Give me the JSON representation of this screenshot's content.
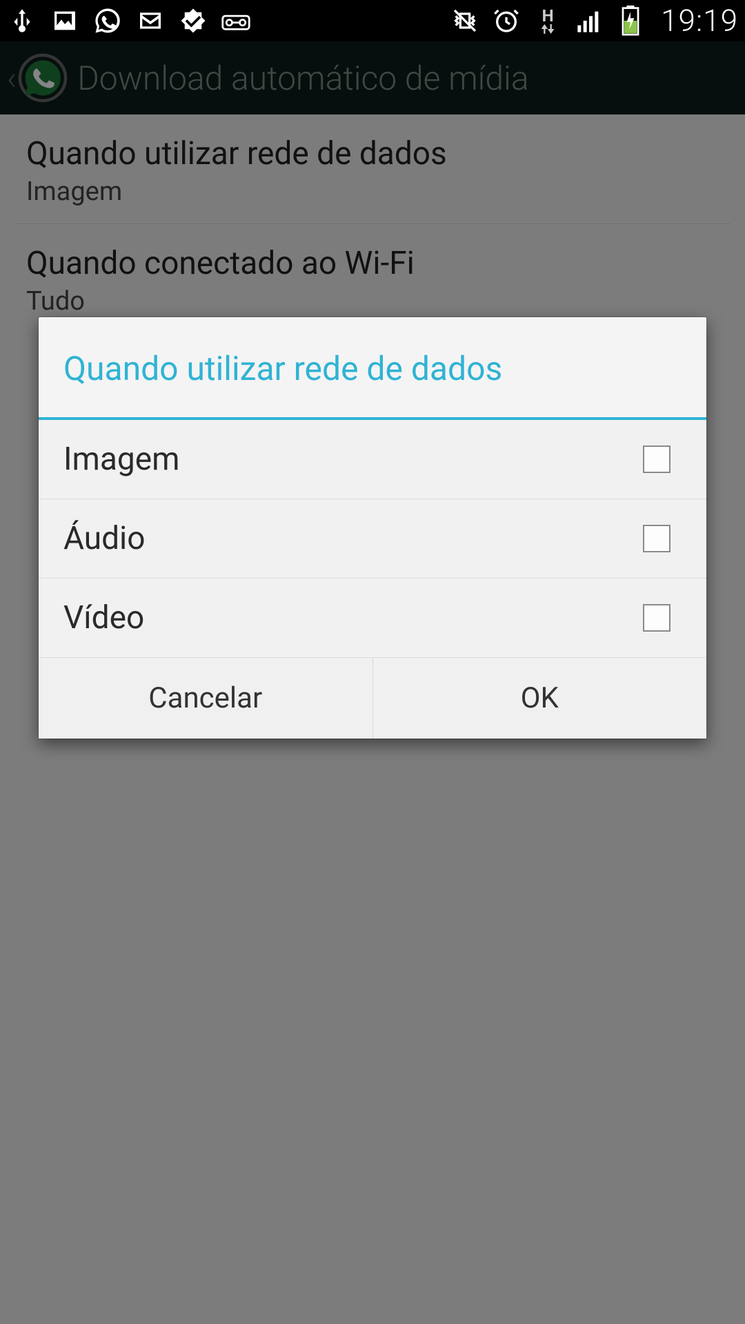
{
  "status": {
    "time": "19:19",
    "icons_left": [
      "usb",
      "picture",
      "whatsapp",
      "gmail",
      "check",
      "voicemail"
    ],
    "icons_right": [
      "vibrate",
      "alarm",
      "data-h",
      "signal",
      "battery-charging"
    ]
  },
  "appbar": {
    "title": "Download automático de mídia"
  },
  "settings": [
    {
      "title": "Quando utilizar rede de dados",
      "subtitle": "Imagem"
    },
    {
      "title": "Quando conectado ao Wi-Fi",
      "subtitle": "Tudo"
    }
  ],
  "dialog": {
    "title": "Quando utilizar rede de dados",
    "options": [
      {
        "label": "Imagem",
        "checked": false
      },
      {
        "label": "Áudio",
        "checked": false
      },
      {
        "label": "Vídeo",
        "checked": false
      }
    ],
    "cancel": "Cancelar",
    "ok": "OK"
  }
}
